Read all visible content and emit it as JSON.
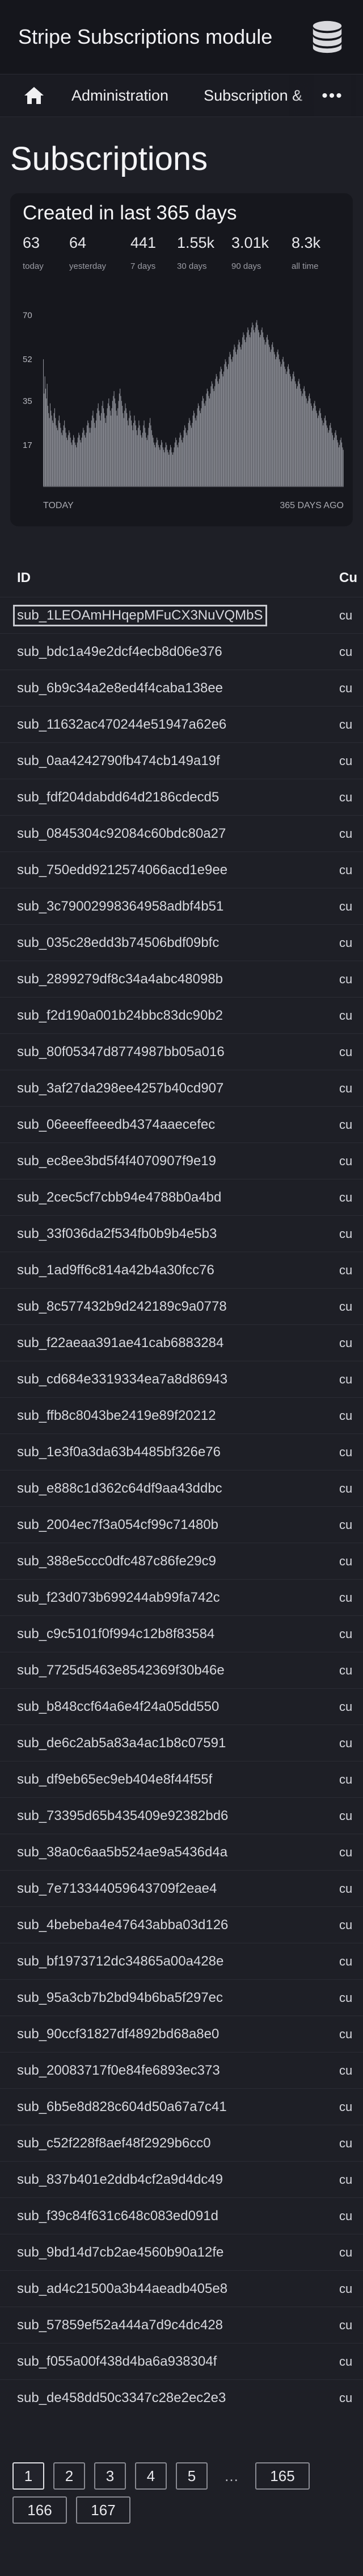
{
  "app": {
    "title": "Stripe Subscriptions module"
  },
  "nav": {
    "home_icon": "home-icon",
    "items": [
      "Administration",
      "Subscription &"
    ],
    "more_label": "•••"
  },
  "page": {
    "title": "Subscriptions"
  },
  "stats_card": {
    "title": "Created in last 365 days",
    "stats": [
      {
        "value": "63",
        "label": "today"
      },
      {
        "value": "64",
        "label": "yesterday"
      },
      {
        "value": "441",
        "label": "7 days"
      },
      {
        "value": "1.55k",
        "label": "30 days"
      },
      {
        "value": "3.01k",
        "label": "90 days"
      },
      {
        "value": "8.3k",
        "label": "all time"
      }
    ]
  },
  "chart_data": {
    "type": "bar",
    "title": "",
    "x_start_label": "TODAY",
    "x_end_label": "365 DAYS AGO",
    "yticks": [
      17,
      35,
      52,
      70
    ],
    "ylim": [
      0,
      72
    ],
    "values_note_order": "index 0 = today (left), index 364 = 365 days ago (right)",
    "values": [
      52,
      38,
      45,
      40,
      36,
      42,
      33,
      30,
      28,
      34,
      31,
      29,
      27,
      26,
      30,
      32,
      28,
      25,
      24,
      23,
      27,
      29,
      26,
      24,
      22,
      21,
      23,
      25,
      27,
      24,
      22,
      20,
      19,
      21,
      23,
      22,
      20,
      18,
      17,
      19,
      21,
      20,
      18,
      17,
      16,
      18,
      20,
      22,
      21,
      19,
      18,
      20,
      22,
      24,
      23,
      21,
      20,
      22,
      25,
      27,
      26,
      24,
      22,
      24,
      27,
      29,
      31,
      28,
      26,
      24,
      27,
      30,
      32,
      34,
      31,
      29,
      27,
      30,
      33,
      35,
      32,
      30,
      28,
      26,
      29,
      32,
      34,
      36,
      33,
      31,
      29,
      32,
      35,
      37,
      39,
      36,
      34,
      31,
      29,
      32,
      35,
      38,
      40,
      37,
      35,
      33,
      30,
      28,
      31,
      34,
      32,
      30,
      27,
      25,
      28,
      31,
      29,
      27,
      25,
      23,
      26,
      29,
      27,
      25,
      23,
      21,
      24,
      27,
      25,
      23,
      21,
      20,
      22,
      25,
      27,
      24,
      22,
      20,
      19,
      21,
      24,
      26,
      28,
      25,
      23,
      21,
      20,
      18,
      17,
      16,
      18,
      20,
      19,
      17,
      16,
      15,
      17,
      19,
      18,
      16,
      15,
      14,
      16,
      18,
      17,
      15,
      14,
      13,
      15,
      17,
      16,
      14,
      13,
      14,
      16,
      18,
      20,
      19,
      17,
      16,
      18,
      20,
      22,
      21,
      19,
      18,
      20,
      23,
      25,
      24,
      22,
      21,
      23,
      26,
      28,
      27,
      25,
      24,
      26,
      29,
      31,
      30,
      28,
      27,
      29,
      32,
      34,
      33,
      31,
      30,
      32,
      35,
      37,
      36,
      34,
      33,
      35,
      38,
      40,
      39,
      37,
      36,
      38,
      41,
      43,
      42,
      40,
      39,
      41,
      44,
      46,
      45,
      43,
      42,
      44,
      47,
      49,
      48,
      46,
      45,
      47,
      50,
      52,
      51,
      49,
      48,
      50,
      53,
      55,
      54,
      52,
      51,
      53,
      56,
      58,
      57,
      55,
      54,
      56,
      58,
      60,
      59,
      57,
      56,
      58,
      61,
      63,
      62,
      60,
      59,
      61,
      63,
      65,
      64,
      62,
      61,
      63,
      65,
      67,
      66,
      64,
      63,
      65,
      67,
      68,
      66,
      64,
      63,
      61,
      62,
      64,
      65,
      63,
      61,
      60,
      58,
      59,
      61,
      62,
      60,
      58,
      57,
      55,
      56,
      58,
      59,
      57,
      55,
      54,
      52,
      53,
      55,
      56,
      54,
      52,
      51,
      49,
      50,
      52,
      53,
      51,
      49,
      48,
      46,
      47,
      49,
      50,
      48,
      46,
      45,
      43,
      44,
      46,
      47,
      45,
      43,
      42,
      40,
      41,
      43,
      44,
      42,
      40,
      39,
      37,
      38,
      40,
      41,
      39,
      37,
      36,
      34,
      35,
      37,
      38,
      36,
      34,
      33,
      31,
      32,
      34,
      35,
      33,
      31,
      30,
      28,
      29,
      31,
      32,
      30,
      28,
      27,
      25,
      26,
      28,
      29,
      27,
      25,
      24,
      22,
      23,
      25,
      26,
      24,
      22,
      21,
      19,
      20,
      22,
      23,
      21,
      19,
      18,
      16,
      17,
      19,
      20,
      18,
      16,
      15
    ]
  },
  "table": {
    "columns": [
      "ID",
      "Cu"
    ],
    "rows": [
      {
        "id": "sub_1LEOAmHHqepMFuCX3NuVQMbS",
        "c": "cu",
        "selected": true
      },
      {
        "id": "sub_bdc1a49e2dcf4ecb8d06e376",
        "c": "cu"
      },
      {
        "id": "sub_6b9c34a2e8ed4f4caba138ee",
        "c": "cu"
      },
      {
        "id": "sub_11632ac470244e51947a62e6",
        "c": "cu"
      },
      {
        "id": "sub_0aa4242790fb474cb149a19f",
        "c": "cu"
      },
      {
        "id": "sub_fdf204dabdd64d2186cdecd5",
        "c": "cu"
      },
      {
        "id": "sub_0845304c92084c60bdc80a27",
        "c": "cu"
      },
      {
        "id": "sub_750edd9212574066acd1e9ee",
        "c": "cu"
      },
      {
        "id": "sub_3c79002998364958adbf4b51",
        "c": "cu"
      },
      {
        "id": "sub_035c28edd3b74506bdf09bfc",
        "c": "cu"
      },
      {
        "id": "sub_2899279df8c34a4abc48098b",
        "c": "cu"
      },
      {
        "id": "sub_f2d190a001b24bbc83dc90b2",
        "c": "cu"
      },
      {
        "id": "sub_80f05347d8774987bb05a016",
        "c": "cu"
      },
      {
        "id": "sub_3af27da298ee4257b40cd907",
        "c": "cu"
      },
      {
        "id": "sub_06eeeffeeedb4374aaecefec",
        "c": "cu"
      },
      {
        "id": "sub_ec8ee3bd5f4f4070907f9e19",
        "c": "cu"
      },
      {
        "id": "sub_2cec5cf7cbb94e4788b0a4bd",
        "c": "cu"
      },
      {
        "id": "sub_33f036da2f534fb0b9b4e5b3",
        "c": "cu"
      },
      {
        "id": "sub_1ad9ff6c814a42b4a30fcc76",
        "c": "cu"
      },
      {
        "id": "sub_8c577432b9d242189c9a0778",
        "c": "cu"
      },
      {
        "id": "sub_f22aeaa391ae41cab6883284",
        "c": "cu"
      },
      {
        "id": "sub_cd684e3319334ea7a8d86943",
        "c": "cu"
      },
      {
        "id": "sub_ffb8c8043be2419e89f20212",
        "c": "cu"
      },
      {
        "id": "sub_1e3f0a3da63b4485bf326e76",
        "c": "cu"
      },
      {
        "id": "sub_e888c1d362c64df9aa43ddbc",
        "c": "cu"
      },
      {
        "id": "sub_2004ec7f3a054cf99c71480b",
        "c": "cu"
      },
      {
        "id": "sub_388e5ccc0dfc487c86fe29c9",
        "c": "cu"
      },
      {
        "id": "sub_f23d073b699244ab99fa742c",
        "c": "cu"
      },
      {
        "id": "sub_c9c5101f0f994c12b8f83584",
        "c": "cu"
      },
      {
        "id": "sub_7725d5463e8542369f30b46e",
        "c": "cu"
      },
      {
        "id": "sub_b848ccf64a6e4f24a05dd550",
        "c": "cu"
      },
      {
        "id": "sub_de6c2ab5a83a4ac1b8c07591",
        "c": "cu"
      },
      {
        "id": "sub_df9eb65ec9eb404e8f44f55f",
        "c": "cu"
      },
      {
        "id": "sub_73395d65b435409e92382bd6",
        "c": "cu"
      },
      {
        "id": "sub_38a0c6aa5b524ae9a5436d4a",
        "c": "cu"
      },
      {
        "id": "sub_7e713344059643709f2eae4",
        "c": "cu"
      },
      {
        "id": "sub_4bebeba4e47643abba03d126",
        "c": "cu"
      },
      {
        "id": "sub_bf1973712dc34865a00a428e",
        "c": "cu"
      },
      {
        "id": "sub_95a3cb7b2bd94b6ba5f297ec",
        "c": "cu"
      },
      {
        "id": "sub_90ccf31827df4892bd68a8e0",
        "c": "cu"
      },
      {
        "id": "sub_20083717f0e84fe6893ec373",
        "c": "cu"
      },
      {
        "id": "sub_6b5e8d828c604d50a67a7c41",
        "c": "cu"
      },
      {
        "id": "sub_c52f228f8aef48f2929b6cc0",
        "c": "cu"
      },
      {
        "id": "sub_837b401e2ddb4cf2a9d4dc49",
        "c": "cu"
      },
      {
        "id": "sub_f39c84f631c648c083ed091d",
        "c": "cu"
      },
      {
        "id": "sub_9bd14d7cb2ae4560b90a12fe",
        "c": "cu"
      },
      {
        "id": "sub_ad4c21500a3b44aeadb405e8",
        "c": "cu"
      },
      {
        "id": "sub_57859ef52a444a7d9c4dc428",
        "c": "cu"
      },
      {
        "id": "sub_f055a00f438d4ba6a938304f",
        "c": "cu"
      },
      {
        "id": "sub_de458dd50c3347c28e2ec2e3",
        "c": "cu"
      }
    ]
  },
  "pagination": {
    "pages": [
      "1",
      "2",
      "3",
      "4",
      "5",
      "…",
      "165",
      "166",
      "167"
    ],
    "current": "1"
  },
  "colors": {
    "background": "#1e1f26",
    "topbar": "#15161c",
    "card": "#16171d",
    "bar": "#8d8f97"
  }
}
